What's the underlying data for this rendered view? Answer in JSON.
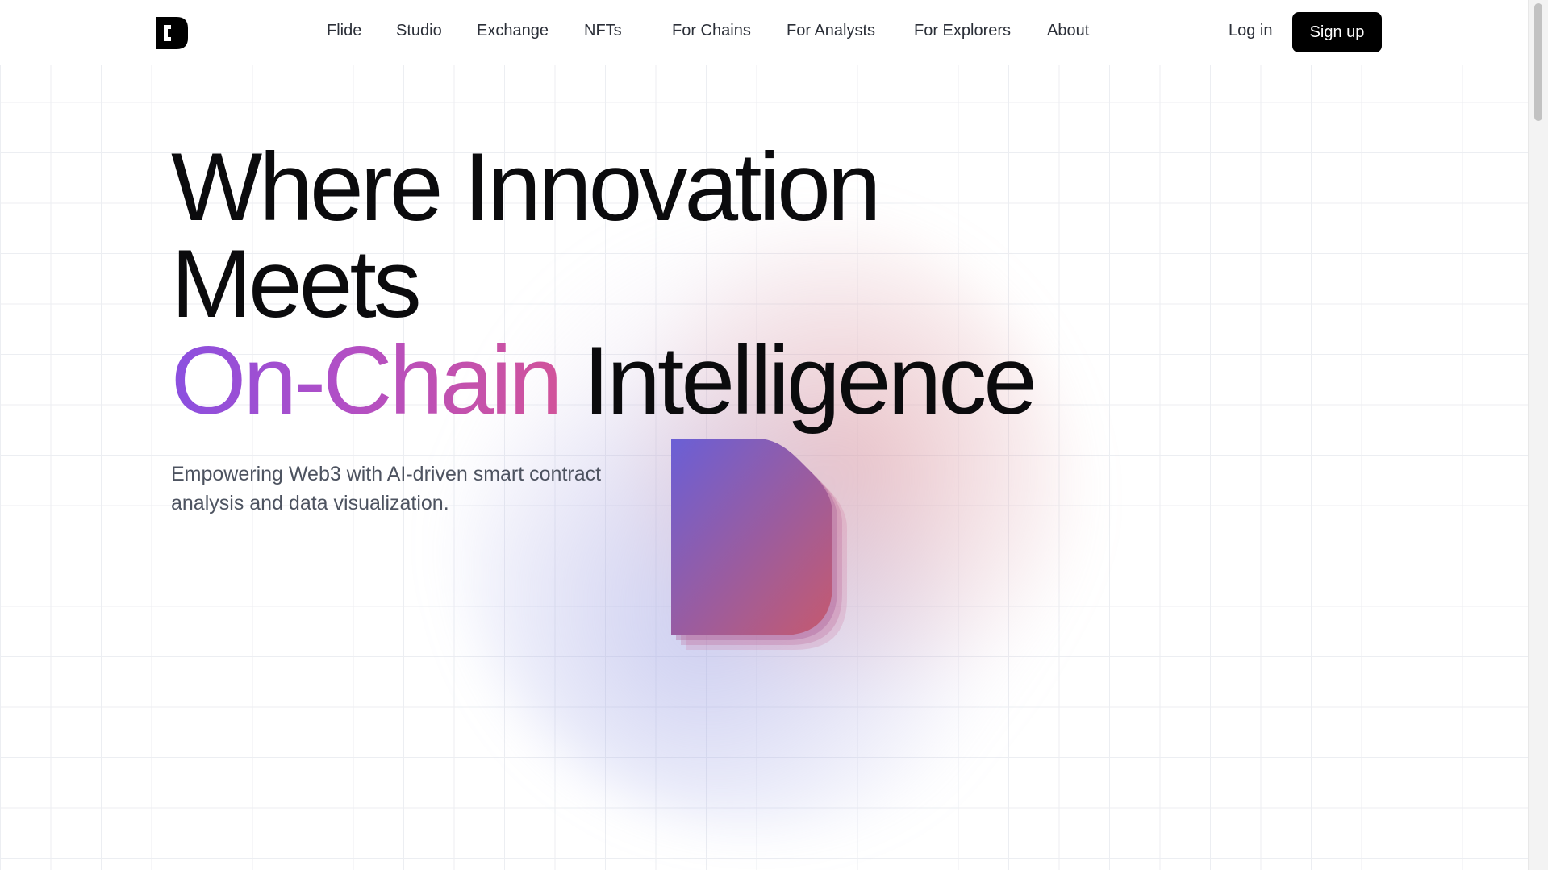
{
  "header": {
    "logo_icon": "brand-d-logo-icon",
    "nav": [
      {
        "label": "Flide"
      },
      {
        "label": "Studio"
      },
      {
        "label": "Exchange"
      },
      {
        "label": "NFTs"
      },
      {
        "label": "For Chains"
      },
      {
        "label": "For Analysts"
      },
      {
        "label": "For Explorers"
      },
      {
        "label": "About"
      }
    ],
    "login_label": "Log in",
    "signup_label": "Sign up"
  },
  "hero": {
    "title_line1": "Where Innovation",
    "title_line2": "Meets",
    "title_line3_accent": "On-Chain",
    "title_line3_rest": " Intelligence",
    "subtitle": "Empowering Web3 with AI-driven smart contract analysis and data visualization."
  },
  "colors": {
    "accent_start": "#8a4fe0",
    "accent_end": "#d1539a",
    "shape_start": "#6a5fd6",
    "shape_end": "#c65a6e",
    "text_dark": "#0b0b0d",
    "button_bg": "#000000"
  }
}
